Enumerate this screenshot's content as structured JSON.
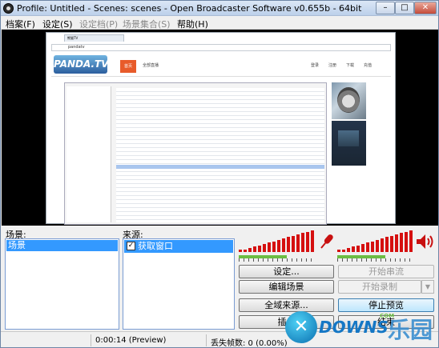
{
  "window": {
    "title": "Profile: Untitled - Scenes: scenes - Open Broadcaster Software v0.655b - 64bit",
    "controls": {
      "minimize": "–",
      "maximize": "□",
      "close": "✕"
    }
  },
  "menu": [
    {
      "label": "档案(F)",
      "enabled": true
    },
    {
      "label": "设定(S)",
      "enabled": true
    },
    {
      "label": "设定档(P)",
      "enabled": false
    },
    {
      "label": "场景集合(S)",
      "enabled": false
    },
    {
      "label": "帮助(H)",
      "enabled": true
    }
  ],
  "preview": {
    "browser_url": "pandatv",
    "browser_tab": "熊猫TV",
    "logo_text": "PANDA.TV",
    "nav_active": "首页",
    "nav_second": "全部直播",
    "nav_right": [
      "登录",
      "注册",
      "下载",
      "充值"
    ]
  },
  "scenes": {
    "label": "场景:",
    "items": [
      "场景"
    ],
    "selected": 0
  },
  "sources": {
    "label": "来源:",
    "items": [
      {
        "label": "获取窗口",
        "checked": true
      }
    ]
  },
  "buttons": {
    "settings": "设定...",
    "edit_scene": "编辑场景",
    "global_sources": "全域来源...",
    "plugins": "插件",
    "start_streaming": "开始串流",
    "start_recording": "开始录制",
    "stop_preview": "停止预览",
    "exit": "结束"
  },
  "audio": {
    "mic_icon": "microphone-icon",
    "speaker_icon": "speaker-icon",
    "mic_level": 0.6,
    "desktop_level": 0.6,
    "color_level": "#d50f0f",
    "color_ok": "#6bbd43"
  },
  "status": {
    "time": "0:00:14 (Preview)",
    "dropped": "丢失帧数: 0 (0.00%)"
  },
  "watermark": {
    "text": "DOWNS",
    "com": "COM",
    "cn": "乐园"
  }
}
